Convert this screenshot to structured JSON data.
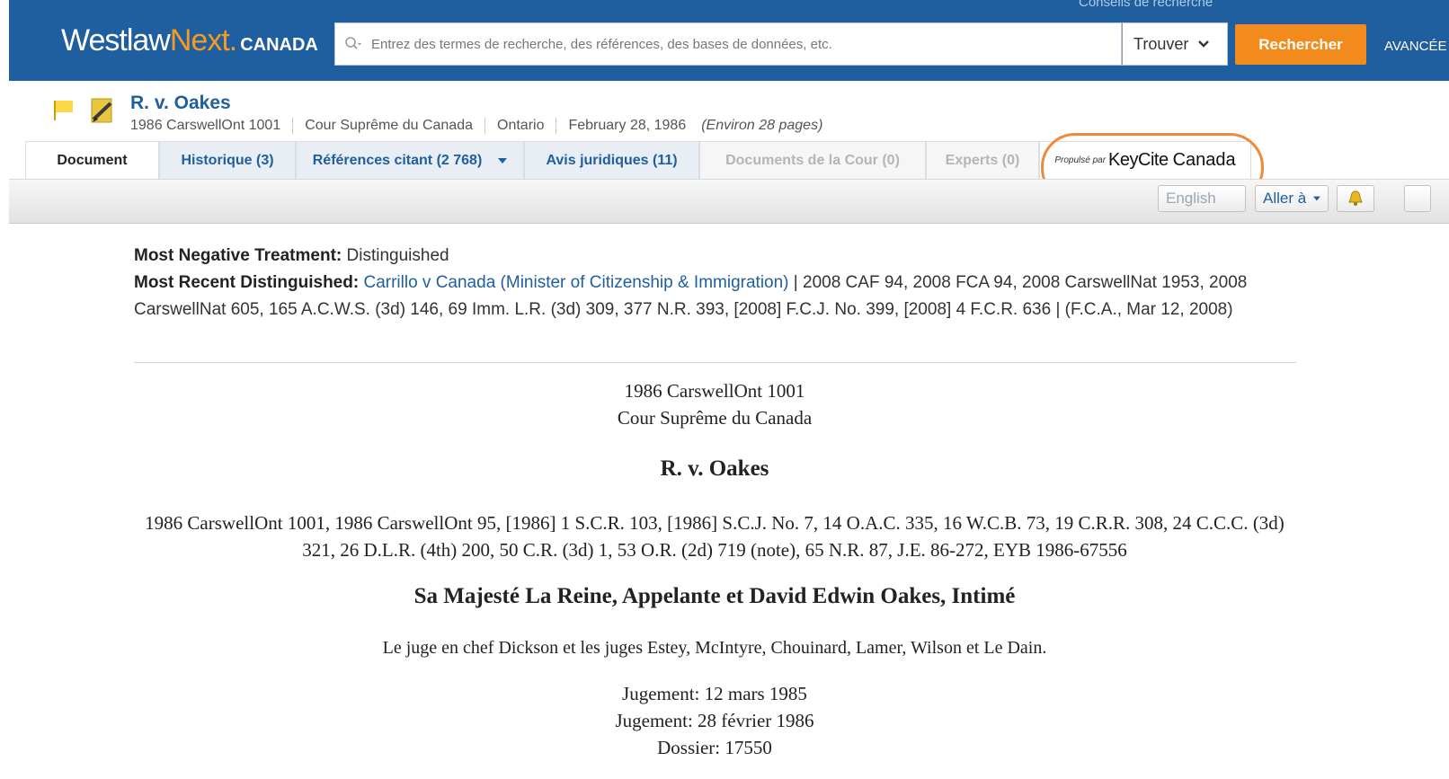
{
  "header": {
    "logo_westlaw": "Westlaw",
    "logo_next": "Next.",
    "logo_canada": "CANADA",
    "tips_link": "Conseils de recherche",
    "search_placeholder": "Entrez des termes de recherche, des références, des bases de données, etc.",
    "search_value": "",
    "find_label": "Trouver",
    "search_button": "Rechercher",
    "advanced_label": "AVANCÉE",
    "brand_color": "#1f5e9f",
    "accent_color": "#f28a1c"
  },
  "document": {
    "title": "R. v. Oakes",
    "citation": "1986 CarswellOnt 1001",
    "court": "Cour Suprême du Canada",
    "jurisdiction": "Ontario",
    "date": "February 28, 1986",
    "pages": "(Environ 28 pages)",
    "flag_icon": "flag-icon",
    "annotation_icon": "pencil-icon"
  },
  "tabs": [
    {
      "label": "Document",
      "state": "active"
    },
    {
      "label": "Historique (3)",
      "state": "link"
    },
    {
      "label": "Références citant (2 768)",
      "state": "link"
    },
    {
      "label": "Avis juridiques (11)",
      "state": "link"
    },
    {
      "label": "Documents de la Cour (0)",
      "state": "disabled"
    },
    {
      "label": "Experts (0)",
      "state": "disabled"
    }
  ],
  "keycite": {
    "powered_by": "Propulsé par",
    "brand_key": "KeyCite",
    "brand_canada": "Canada",
    "highlight_color": "#ef8a3a"
  },
  "toolbar": {
    "english_label": "English",
    "goto_label": "Aller à",
    "bell_icon": "bell-icon"
  },
  "treatment": {
    "negative_label": "Most Negative Treatment:",
    "negative_value": "Distinguished",
    "recent_label": "Most Recent Distinguished:",
    "recent_case": "Carrillo v Canada (Minister of Citizenship & Immigration)",
    "recent_citations": "| 2008 CAF 94, 2008 FCA 94, 2008 CarswellNat 1953, 2008 CarswellNat 605, 165 A.C.W.S. (3d) 146, 69 Imm. L.R. (3d) 309, 377 N.R. 393, [2008] F.C.J. No. 399, [2008] 4 F.C.R. 636 | (F.C.A., Mar 12, 2008)"
  },
  "case_body": {
    "citation": "1986 CarswellOnt 1001",
    "court": "Cour Suprême du Canada",
    "title": "R. v. Oakes",
    "parallel_citations": "1986 CarswellOnt 1001, 1986 CarswellOnt 95, [1986] 1 S.C.R. 103, [1986] S.C.J. No. 7, 14 O.A.C. 335, 16 W.C.B. 73, 19 C.R.R. 308, 24 C.C.C. (3d) 321, 26 D.L.R. (4th) 200, 50 C.R. (3d) 1, 53 O.R. (2d) 719 (note), 65 N.R. 87, J.E. 86-272, EYB 1986-67556",
    "parties": "Sa Majesté La Reine, Appelante et David Edwin Oakes, Intimé",
    "judges": "Le juge en chef Dickson et les juges Estey, McIntyre, Chouinard, Lamer, Wilson et Le Dain.",
    "hearing": "Jugement: 12 mars 1985",
    "judgment": "Jugement: 28 février 1986",
    "file": "Dossier: 17550"
  }
}
